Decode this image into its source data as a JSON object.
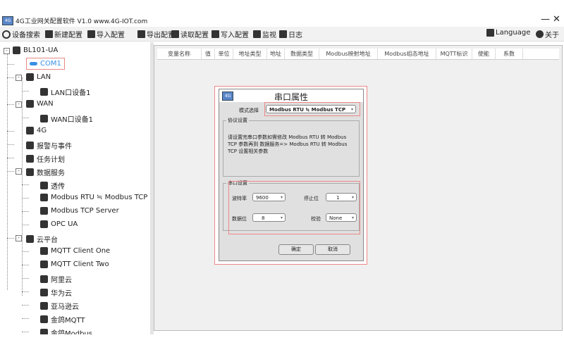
{
  "window": {
    "title": "4G工业网关配置软件 V1.0 www.4G-IOT.com",
    "close": "✕",
    "minimize": "—"
  },
  "toolbar": [
    {
      "label": "设备搜索",
      "icon": "search-icon"
    },
    {
      "label": "新建配置",
      "icon": "new-config-icon"
    },
    {
      "label": "导入配置",
      "icon": "import-icon"
    },
    {
      "label": "导出配置",
      "icon": "export-icon"
    },
    {
      "label": "读取配置",
      "icon": "upload-icon"
    },
    {
      "label": "写入配置",
      "icon": "download-icon"
    },
    {
      "label": "监视",
      "icon": "monitor-icon"
    },
    {
      "label": "日志",
      "icon": "log-icon"
    }
  ],
  "toolbar_right": {
    "language": "Language",
    "about": "关于"
  },
  "tree": [
    {
      "label": "BL101-UA",
      "level": 0,
      "expand": "-"
    },
    {
      "label": "COM1",
      "level": 1,
      "selected": true
    },
    {
      "label": "LAN",
      "level": 1,
      "expand": "-"
    },
    {
      "label": "LAN口设备1",
      "level": 2
    },
    {
      "label": "WAN",
      "level": 1,
      "expand": "-"
    },
    {
      "label": "WAN口设备1",
      "level": 2
    },
    {
      "label": "4G",
      "level": 1
    },
    {
      "label": "报警与事件",
      "level": 1
    },
    {
      "label": "任务计划",
      "level": 1
    },
    {
      "label": "数据服务",
      "level": 1,
      "expand": "-"
    },
    {
      "label": "透传",
      "level": 2
    },
    {
      "label": "Modbus RTU ≒ Modbus TCP",
      "level": 2
    },
    {
      "label": "Modbus TCP Server",
      "level": 2
    },
    {
      "label": "OPC UA",
      "level": 2
    },
    {
      "label": "云平台",
      "level": 1,
      "expand": "-"
    },
    {
      "label": "MQTT Client One",
      "level": 2
    },
    {
      "label": "MQTT Client Two",
      "level": 2
    },
    {
      "label": "阿里云",
      "level": 2
    },
    {
      "label": "华为云",
      "level": 2
    },
    {
      "label": "亚马逊云",
      "level": 2
    },
    {
      "label": "金鸽MQTT",
      "level": 2
    },
    {
      "label": "金鸽Modbus",
      "level": 2
    }
  ],
  "table": {
    "columns": [
      "变量名称",
      "值",
      "单位",
      "地址类型",
      "地址",
      "数据类型",
      "Modbus映射地址",
      "Modbus组态地址",
      "MQTT标识",
      "使能",
      "系数"
    ]
  },
  "dialog": {
    "title": "串口属性",
    "mode_label": "模式选择",
    "mode_value": "Modbus RTU ≒ Modbus TCP",
    "protocol_group": "协议设置",
    "protocol_text": "请设置完串口参数如需修改 Modbus RTU 转 Modbus TCP 参数再到 数据服务=> Modbus RTU 转 Modbus TCP 设置相关参数",
    "serial_group": "串口设置",
    "baud_label": "波特率",
    "baud_value": "9600",
    "stop_label": "停止位",
    "stop_value": "1",
    "data_label": "数据位",
    "data_value": "8",
    "parity_label": "校验",
    "parity_value": "None",
    "ok": "确定",
    "cancel": "取消"
  },
  "colors": {
    "highlight": "#e88888",
    "selected_text": "#3a8ee6"
  }
}
